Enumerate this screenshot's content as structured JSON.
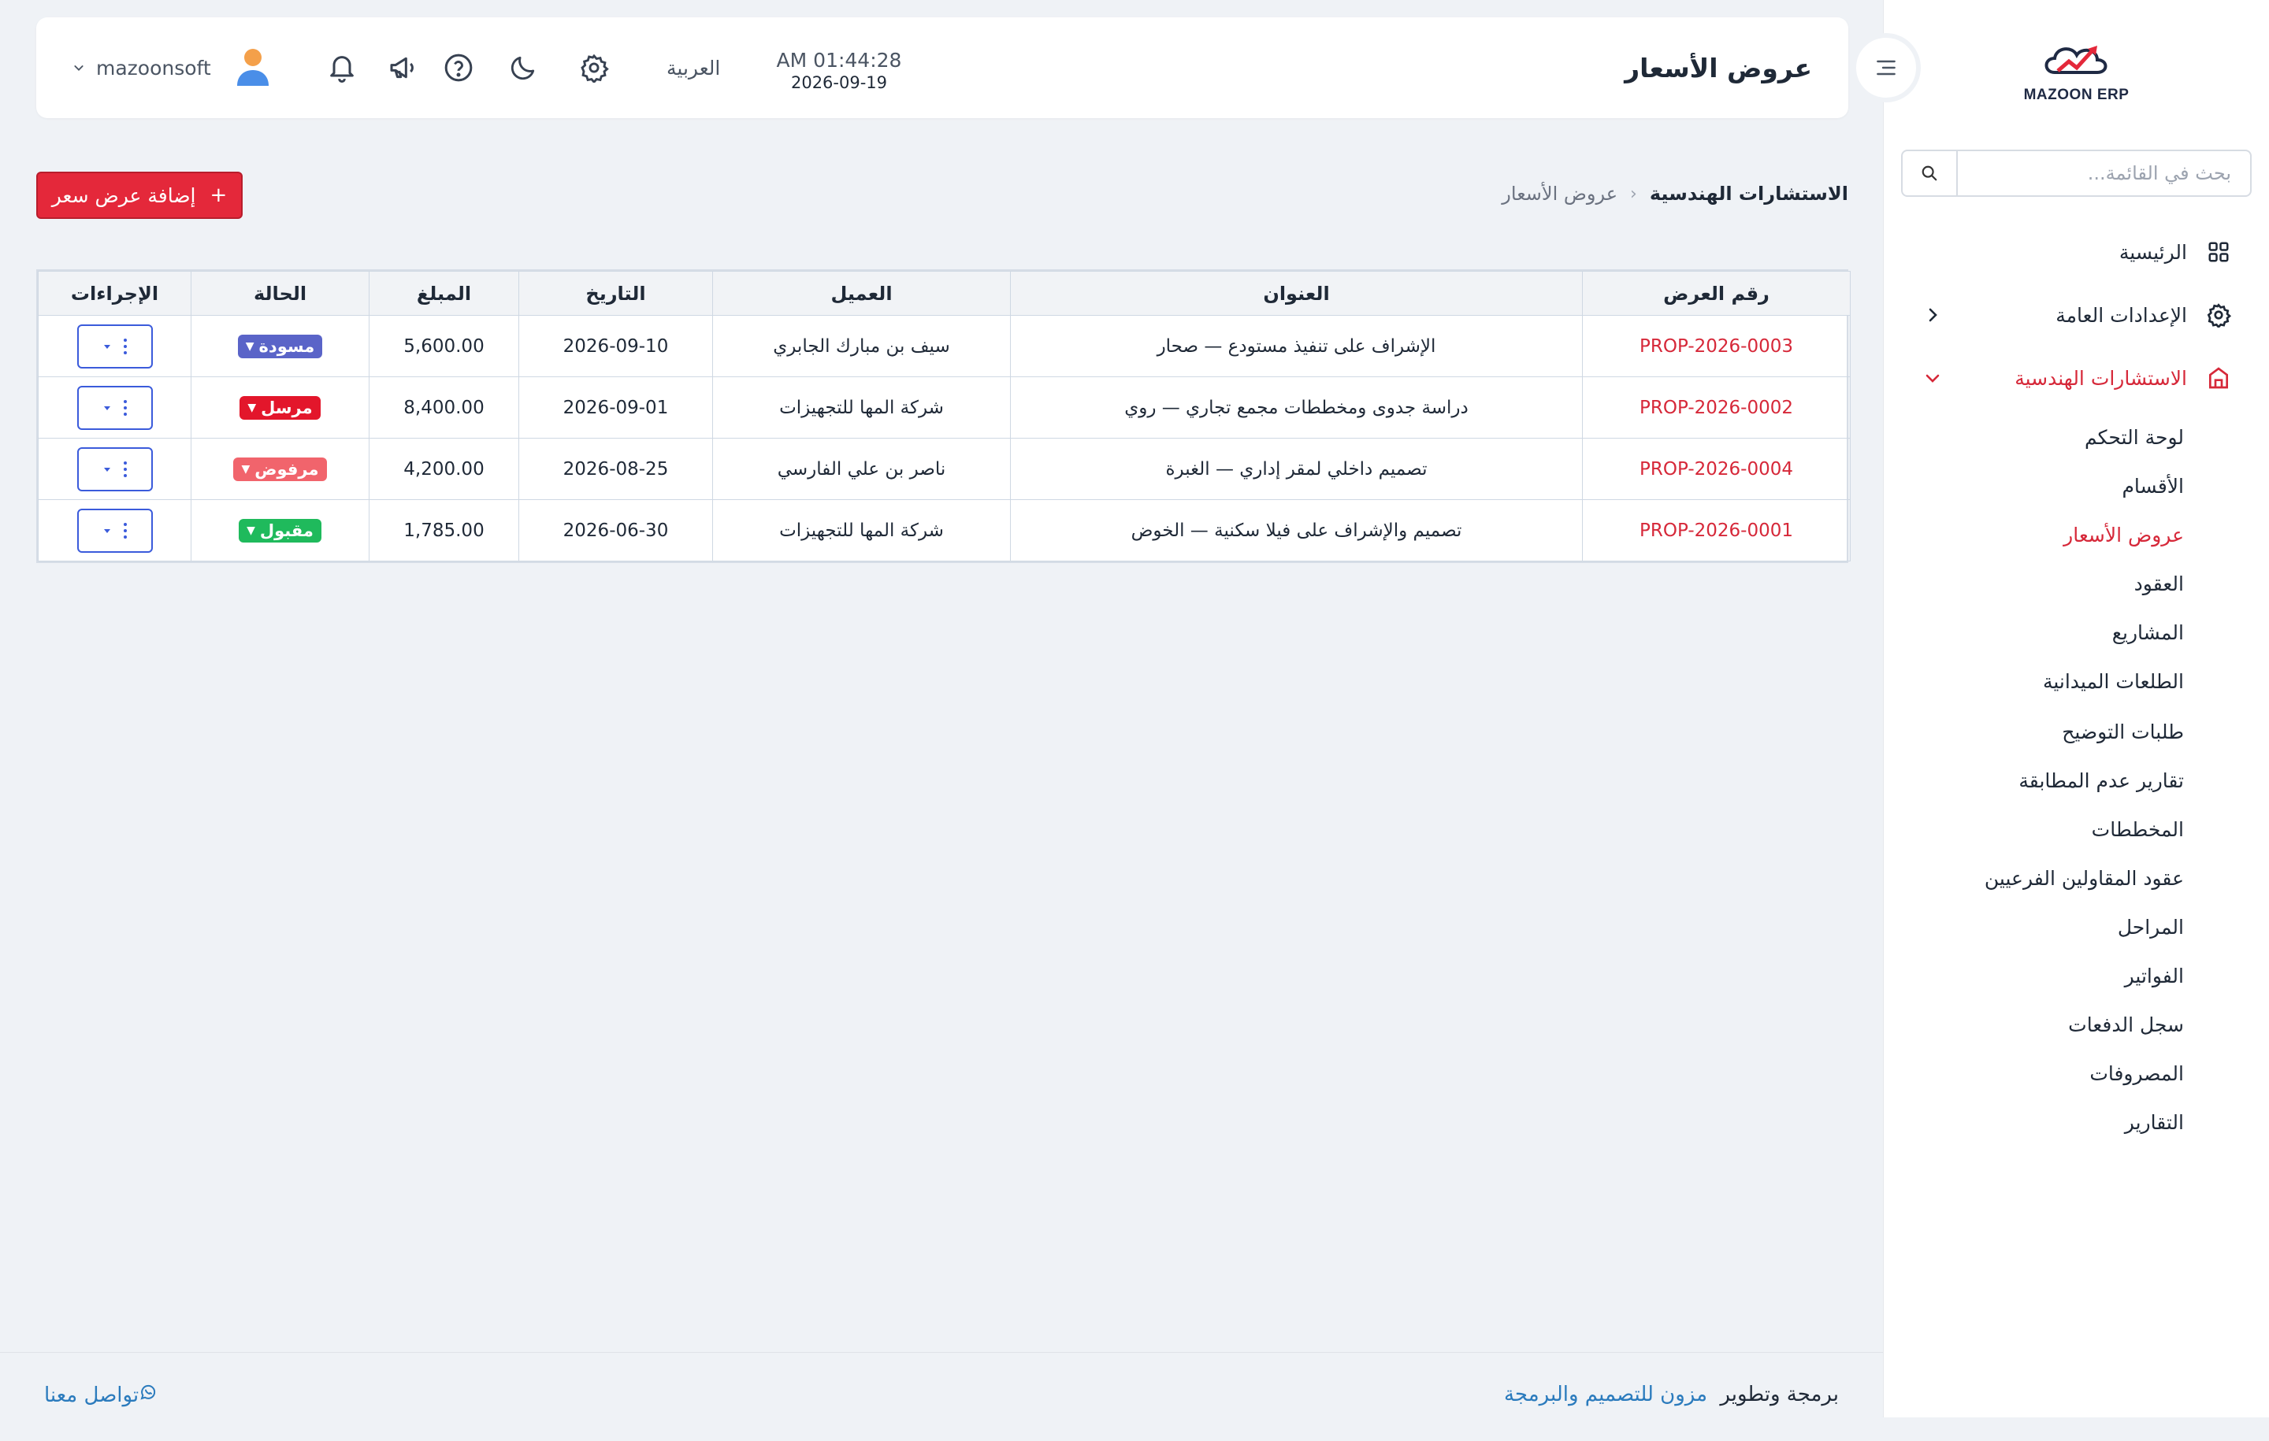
{
  "header": {
    "page_title": "عروض الأسعار",
    "time": "AM 01:44:28",
    "date": "2026-09-19",
    "language": "العربية",
    "username": "mazoonsoft"
  },
  "sidebar": {
    "logo_text": "MAZOON ERP",
    "search_placeholder": "بحث في القائمة...",
    "items": [
      {
        "label": "الرئيسية",
        "icon": "grid-icon"
      },
      {
        "label": "الإعدادات العامة",
        "icon": "gear-icon"
      },
      {
        "label": "الاستشارات الهندسية",
        "icon": "building-icon"
      }
    ],
    "subitems": [
      "لوحة التحكم",
      "الأقسام",
      "عروض الأسعار",
      "العقود",
      "المشاريع",
      "الطلعات الميدانية",
      "طلبات التوضيح",
      "تقارير عدم المطابقة",
      "المخططات",
      "عقود المقاولين الفرعيين",
      "المراحل",
      "الفواتير",
      "سجل الدفعات",
      "المصروفات",
      "التقارير"
    ]
  },
  "breadcrumb": {
    "parent": "الاستشارات الهندسية",
    "current": "عروض الأسعار"
  },
  "add_button": "إضافة عرض سعر",
  "table": {
    "columns": {
      "number": "رقم العرض",
      "title": "العنوان",
      "client": "العميل",
      "date": "التاريخ",
      "amount": "المبلغ",
      "status": "الحالة",
      "actions": "الإجراءات"
    },
    "rows": [
      {
        "number": "PROP-2026-0003",
        "title": "الإشراف على تنفيذ مستودع — صحار",
        "client": "سيف بن مبارك الجابري",
        "date": "2026-09-10",
        "amount": "5,600.00",
        "status": "مسودة",
        "status_color": "#5a64c8"
      },
      {
        "number": "PROP-2026-0002",
        "title": "دراسة جدوى ومخططات مجمع تجاري — روي",
        "client": "شركة المها للتجهيزات",
        "date": "2026-09-01",
        "amount": "8,400.00",
        "status": "مرسل",
        "status_color": "#e3162b"
      },
      {
        "number": "PROP-2026-0004",
        "title": "تصميم داخلي لمقر إداري — الغبرة",
        "client": "ناصر بن علي الفارسي",
        "date": "2026-08-25",
        "amount": "4,200.00",
        "status": "مرفوض",
        "status_color": "#f1646c"
      },
      {
        "number": "PROP-2026-0001",
        "title": "تصميم والإشراف على فيلا سكنية — الخوض",
        "client": "شركة المها للتجهيزات",
        "date": "2026-06-30",
        "amount": "1,785.00",
        "status": "مقبول",
        "status_color": "#1fba5c"
      }
    ]
  },
  "footer": {
    "credit_prefix": "برمجة وتطوير",
    "company": "مزون للتصميم والبرمجة",
    "contact": "تواصل معنا"
  },
  "colors": {
    "accent": "#d62839",
    "link": "#2b7bbd",
    "background": "#eff2f6"
  }
}
